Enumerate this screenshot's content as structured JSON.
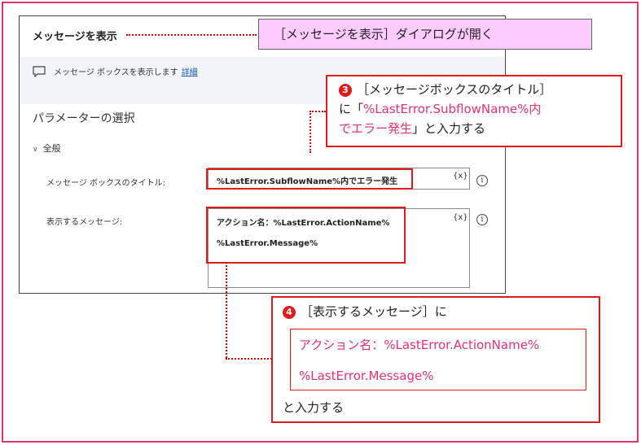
{
  "dialog": {
    "title": "メッセージを表示",
    "description": "メッセージ ボックスを表示します",
    "details_link": "詳細",
    "section_title": "パラメーターの選択",
    "group_label": "全般",
    "group_chevron": "chevron-down-icon",
    "fields": {
      "title_label": "メッセージ ボックスのタイトル:",
      "title_value": "%LastError.SubflowName%内でエラー発生",
      "message_label": "表示するメッセージ:",
      "message_line1": "アクション名：%LastError.ActionName%",
      "message_line2": "%LastError.Message%",
      "variable_button": "{x}",
      "info_icon": "i"
    }
  },
  "annotations": {
    "open_callout": "［メッセージを表示］ダイアログが開く",
    "step3": {
      "badge": "3",
      "line1": "［メッセージボックスのタイトル］",
      "line2_prefix": "に「",
      "line2_highlight": "%LastError.SubflowName%内",
      "line3_highlight": "でエラー発生",
      "line3_suffix": "」と入力する"
    },
    "step4": {
      "badge": "4",
      "heading": "［表示するメッセージ］に",
      "line1": "アクション名：%LastError.ActionName%",
      "line2": "%LastError.Message%",
      "tail": "と入力する"
    }
  },
  "colors": {
    "accent_red": "#e11a1a",
    "accent_magenta": "#e0336f",
    "callout_pink_bg": "#ffccff",
    "link_blue": "#1a5fb4"
  }
}
